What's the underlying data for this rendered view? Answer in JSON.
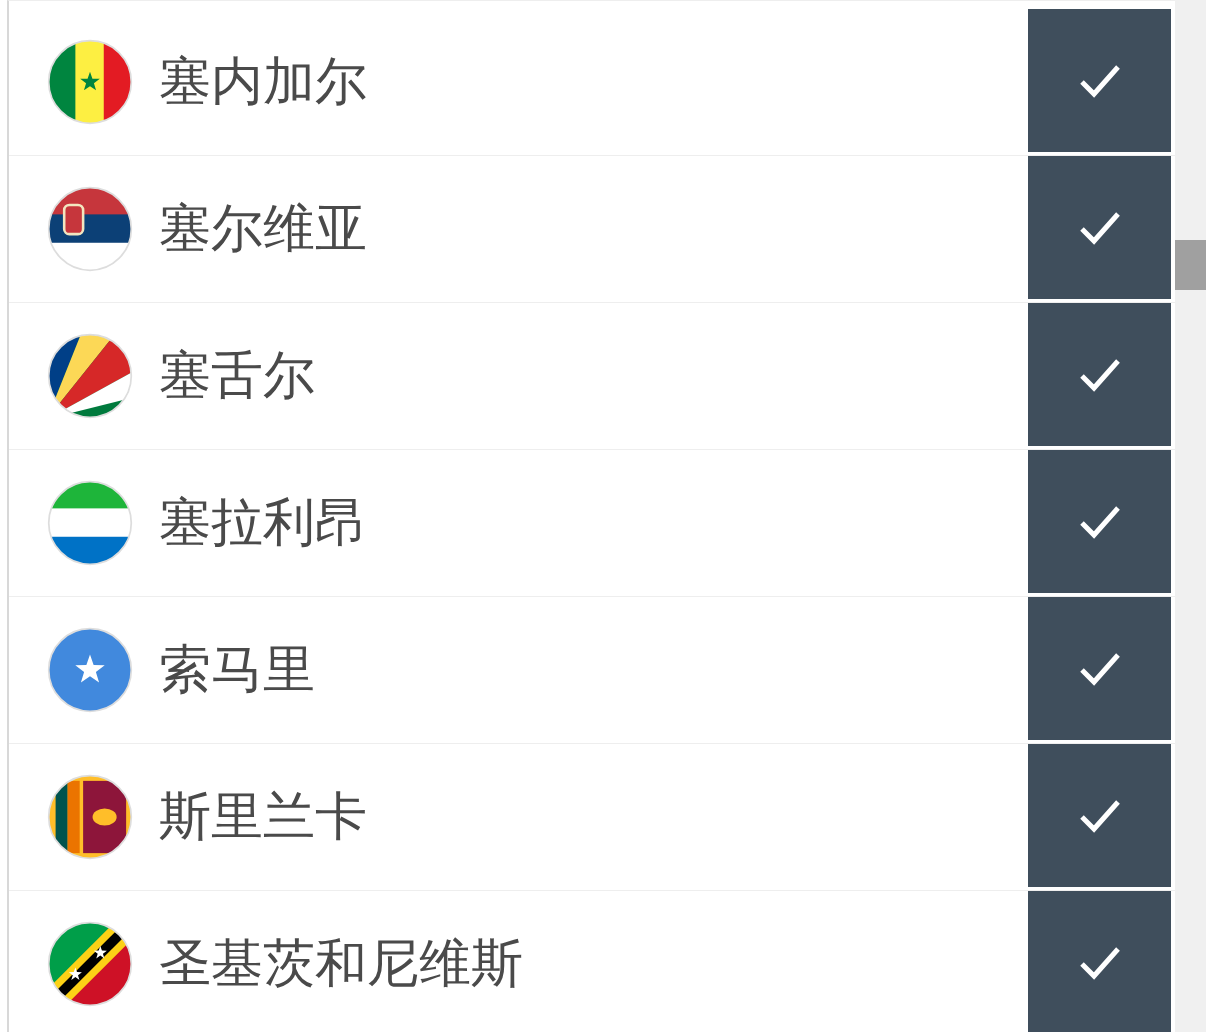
{
  "countries": [
    {
      "name": "塞内加尔",
      "kind": "senegal",
      "checked": true
    },
    {
      "name": "塞尔维亚",
      "kind": "serbia",
      "checked": true
    },
    {
      "name": "塞舌尔",
      "kind": "seychelles",
      "checked": true
    },
    {
      "name": "塞拉利昂",
      "kind": "sierraleone",
      "checked": true
    },
    {
      "name": "索马里",
      "kind": "somalia",
      "checked": true
    },
    {
      "name": "斯里兰卡",
      "kind": "srilanka",
      "checked": true
    },
    {
      "name": "圣基茨和尼维斯",
      "kind": "stkitts",
      "checked": true
    }
  ]
}
